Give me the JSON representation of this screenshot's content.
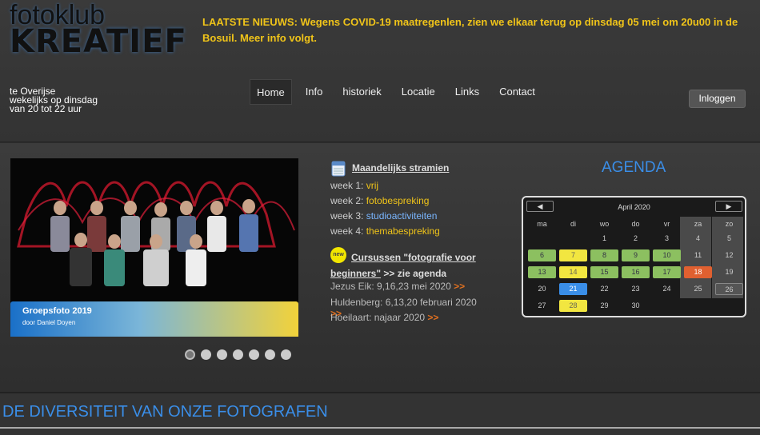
{
  "header": {
    "logo_line1": "fotoklub",
    "logo_line2": "KREATIEF",
    "news": "LAATSTE NIEUWS: Wegens COVID-19 maatregenlen, zien we elkaar terug op dinsdag 05 mei om 20u00 in de Bosuil. Meer info volgt.",
    "tagline": [
      "te Overijse",
      "wekelijks op dinsdag",
      "van 20 tot 22 uur"
    ],
    "login_label": "Inloggen"
  },
  "nav": {
    "items": [
      {
        "label": "Home",
        "active": true
      },
      {
        "label": "Info"
      },
      {
        "label": "historiek"
      },
      {
        "label": "Locatie"
      },
      {
        "label": "Links"
      },
      {
        "label": "Contact"
      }
    ]
  },
  "slider": {
    "caption_title": "Groepsfoto 2019",
    "caption_sub": "door Daniel Doyen",
    "dot_count": 7,
    "active_dot": 1
  },
  "monthly": {
    "title": "Maandelijks stramien",
    "weeks": [
      {
        "label": "week 1:",
        "value": "vrij"
      },
      {
        "label": "week 2:",
        "value": "fotobespreking"
      },
      {
        "label": "week 3:",
        "value": "studioactiviteiten"
      },
      {
        "label": "week 4:",
        "value": "themabespreking"
      }
    ]
  },
  "courses": {
    "badge": "new",
    "title_link": "Cursussen \"fotografie voor beginners\"",
    "title_suffix": " >> zie agenda",
    "sessions": [
      {
        "text": "Jezus Eik: 9,16,23 mei 2020",
        "arrow": ">>"
      },
      {
        "text": "Huldenberg: 6,13,20 februari 2020",
        "arrow": ">>"
      },
      {
        "text": "Hoeilaart: najaar 2020",
        "arrow": ">>"
      }
    ]
  },
  "agenda": {
    "title": "AGENDA",
    "month": "April 2020",
    "prev": "◀",
    "next": "▶",
    "dows": [
      "ma",
      "di",
      "wo",
      "do",
      "vr",
      "za",
      "zo"
    ],
    "rows": [
      [
        "",
        "",
        "1",
        "2",
        "3",
        "4",
        "5"
      ],
      [
        "6",
        "7",
        "8",
        "9",
        "10",
        "11",
        "12"
      ],
      [
        "13",
        "14",
        "15",
        "16",
        "17",
        "18",
        "19"
      ],
      [
        "20",
        "21",
        "22",
        "23",
        "24",
        "25",
        "26"
      ],
      [
        "27",
        "28",
        "29",
        "30",
        "",
        "",
        ""
      ]
    ],
    "colors": {
      "event_green": "#8cc060",
      "event_yellow": "#f2e640",
      "event_red": "#e06030",
      "today_blue": "#3a8ee8"
    }
  },
  "footer": {
    "title": "DE DIVERSITEIT VAN ONZE FOTOGRAFEN"
  }
}
